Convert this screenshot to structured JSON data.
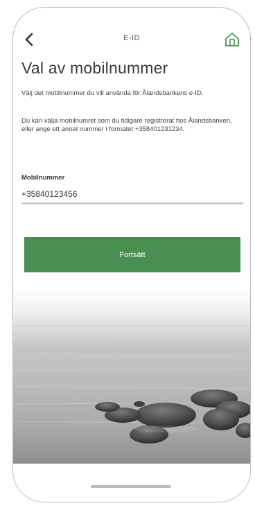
{
  "header": {
    "title": "E-ID",
    "back_icon": "chevron-left-icon",
    "home_icon": "home-icon"
  },
  "main": {
    "title": "Val av mobilnummer",
    "description_1": "Välj det mobilnummer du vill använda för Ålandsbankens e-ID.",
    "description_2": "Du kan välja mobilnumret som du tidigare registrerat hos Ålandsbanken, eller ange ett annat nummer i formatet +358401231234.",
    "field_label": "Mobilnummer",
    "field_value": "+35840123456",
    "continue_label": "Fortsätt"
  },
  "colors": {
    "accent": "#4a8f51",
    "home_icon": "#4a8f51"
  }
}
